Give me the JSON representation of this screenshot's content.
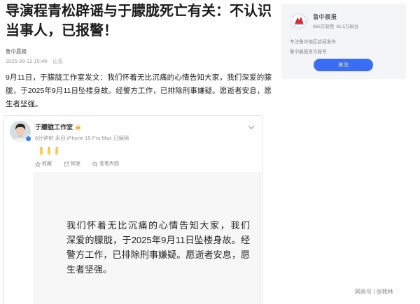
{
  "article": {
    "title": "导演程青松辟谣与于朦胧死亡有关：不认识当事人，已报警！",
    "source": "鲁中晨报",
    "datetime": "2025-09-12 15:49",
    "location": "山东",
    "body": "9月11日，于朦胧工作室发文：我们怀着无比沉痛的心情告知大家，我们深爱的朦胧，于2025年9月11日坠楼身故。经警方工作，已排除刑事嫌疑。愿逝者安息，愿生者坚强。"
  },
  "embedded_post": {
    "avatar_icon": "avatar-photo",
    "verified_icon": "verified-badge-icon",
    "author": "于朦胧工作室",
    "author_badge_icon": "crown-icon",
    "meta": "6分钟前 来自 iPhone 15 Pro Max 已编辑",
    "menu_icon": "chevron-down-icon",
    "emojis": [
      "candle-icon",
      "candle-icon",
      "candle-icon"
    ],
    "actions": [
      {
        "label": "收藏",
        "icon": "star-icon"
      },
      {
        "label": "转发",
        "icon": "share-icon"
      },
      {
        "label": "查看大图",
        "icon": "zoom-icon"
      }
    ],
    "image_text_lines": [
      "我们怀着无比沉痛的心情告知大家，我们",
      "深爱的朦胧，于2025年9月11日坠楼身故。经",
      "警方工作，已排除刑事嫌疑。愿逝者安息，愿",
      "生者坚强。"
    ]
  },
  "sidebar": {
    "logo_icon": "newspaper-logo-icon",
    "name": "鲁中晨报",
    "likes": "963万获赞",
    "followers": "81.5万粉丝",
    "description": "专注鲁中地区新闻发布",
    "verification": "鲁中晨报官方账号",
    "follow_label": "关注"
  },
  "watermark": "网易号 | 张我林",
  "colors": {
    "text": "#222222",
    "muted": "#999999",
    "sidebar_bg": "#f4f5f7",
    "follow_button": "#3a6cf4",
    "logo_red": "#d7282f",
    "verified": "#2f7ff5",
    "crown": "#f5a623"
  }
}
